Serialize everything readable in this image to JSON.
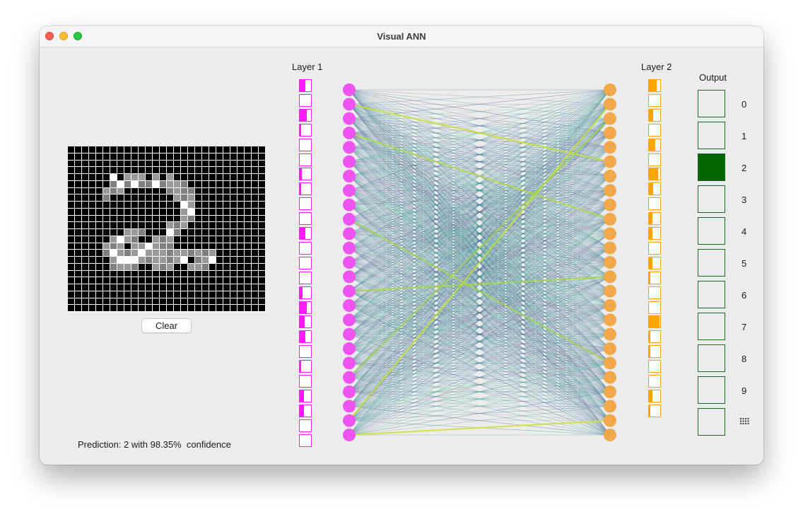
{
  "window": {
    "title": "Visual ANN"
  },
  "input_grid": {
    "size": 28,
    "on_color": "#ffffff",
    "off_color": "#000000",
    "active_levels": {
      "4": [
        [
          6,
          1.0
        ],
        [
          8,
          0.6
        ],
        [
          9,
          0.6
        ],
        [
          10,
          0.6
        ],
        [
          12,
          0.6
        ],
        [
          14,
          0.6
        ]
      ],
      "5": [
        [
          6,
          0.5
        ],
        [
          7,
          1.0
        ],
        [
          8,
          0.5
        ],
        [
          9,
          1.0
        ],
        [
          10,
          0.5
        ],
        [
          11,
          0.5
        ],
        [
          12,
          1.0
        ],
        [
          13,
          0.5
        ],
        [
          14,
          0.6
        ],
        [
          15,
          0.6
        ],
        [
          16,
          0.5
        ]
      ],
      "6": [
        [
          5,
          0.6
        ],
        [
          6,
          0.5
        ],
        [
          7,
          0.6
        ],
        [
          14,
          0.5
        ],
        [
          15,
          0.6
        ],
        [
          16,
          0.5
        ],
        [
          17,
          0.5
        ]
      ],
      "7": [
        [
          5,
          0.5
        ],
        [
          15,
          0.6
        ],
        [
          16,
          0.5
        ],
        [
          17,
          0.6
        ]
      ],
      "8": [
        [
          16,
          1.0
        ],
        [
          17,
          0.6
        ]
      ],
      "9": [
        [
          16,
          0.6
        ],
        [
          17,
          1.0
        ]
      ],
      "10": [
        [
          16,
          0.6
        ],
        [
          17,
          0.5
        ]
      ],
      "11": [
        [
          14,
          0.6
        ],
        [
          15,
          0.5
        ],
        [
          16,
          0.6
        ]
      ],
      "12": [
        [
          8,
          0.6
        ],
        [
          9,
          0.6
        ],
        [
          10,
          0.5
        ],
        [
          14,
          1.0
        ],
        [
          15,
          0.5
        ]
      ],
      "13": [
        [
          6,
          0.6
        ],
        [
          7,
          1.0
        ],
        [
          8,
          0.6
        ],
        [
          9,
          0.5
        ],
        [
          12,
          0.6
        ],
        [
          13,
          0.5
        ],
        [
          14,
          0.6
        ]
      ],
      "14": [
        [
          5,
          0.6
        ],
        [
          6,
          0.5
        ],
        [
          7,
          0.6
        ],
        [
          9,
          0.6
        ],
        [
          10,
          0.6
        ],
        [
          11,
          1.0
        ],
        [
          12,
          0.6
        ],
        [
          13,
          0.5
        ],
        [
          14,
          0.5
        ]
      ],
      "15": [
        [
          5,
          0.5
        ],
        [
          6,
          1.0
        ],
        [
          7,
          0.6
        ],
        [
          8,
          0.5
        ],
        [
          9,
          0.6
        ],
        [
          10,
          1.0
        ],
        [
          11,
          0.6
        ],
        [
          12,
          0.6
        ],
        [
          13,
          0.6
        ],
        [
          14,
          0.5
        ],
        [
          15,
          0.6
        ],
        [
          16,
          0.6
        ],
        [
          17,
          0.5
        ],
        [
          18,
          0.6
        ],
        [
          19,
          0.5
        ],
        [
          20,
          0.6
        ]
      ],
      "16": [
        [
          6,
          0.6
        ],
        [
          7,
          1.0
        ],
        [
          8,
          1.0
        ],
        [
          9,
          1.0
        ],
        [
          10,
          0.6
        ],
        [
          11,
          0.5
        ],
        [
          12,
          0.6
        ],
        [
          13,
          0.6
        ],
        [
          14,
          0.5
        ],
        [
          15,
          0.6
        ],
        [
          16,
          1.0
        ],
        [
          18,
          0.5
        ],
        [
          19,
          0.6
        ],
        [
          20,
          1.0
        ]
      ],
      "17": [
        [
          6,
          0.5
        ],
        [
          7,
          0.6
        ],
        [
          8,
          0.6
        ],
        [
          9,
          0.5
        ],
        [
          12,
          0.6
        ],
        [
          13,
          0.5
        ],
        [
          14,
          0.6
        ],
        [
          17,
          0.6
        ],
        [
          18,
          0.6
        ],
        [
          19,
          0.5
        ]
      ]
    }
  },
  "clear_button": {
    "label": "Clear"
  },
  "prediction": {
    "text": "Prediction: 2 with 98.35%  confidence"
  },
  "layer1": {
    "label": "Layer 1",
    "color": "#ff1aff",
    "activations": [
      0.5,
      0.0,
      0.6,
      0.12,
      0.0,
      0.0,
      0.2,
      0.15,
      0.0,
      0.0,
      0.5,
      0.0,
      0.0,
      0.0,
      0.25,
      0.6,
      0.45,
      0.5,
      0.0,
      0.15,
      0.0,
      0.35,
      0.4,
      0.0,
      0.0
    ]
  },
  "layer2": {
    "label": "Layer 2",
    "color": "#ffa500",
    "activations": [
      0.7,
      0.0,
      0.35,
      0.0,
      0.55,
      0.0,
      0.8,
      0.35,
      0.0,
      0.3,
      0.3,
      0.0,
      0.3,
      0.1,
      0.0,
      0.0,
      0.95,
      0.1,
      0.1,
      0.0,
      0.0,
      0.3,
      0.1
    ]
  },
  "network": {
    "left_node_color": "#f054f0",
    "right_node_color": "#f0a848",
    "left_nodes": 25,
    "right_nodes": 25
  },
  "output": {
    "label": "Output",
    "active_color": "#006400",
    "border_color": "#1c6b1c",
    "digits": [
      "0",
      "1",
      "2",
      "3",
      "4",
      "5",
      "6",
      "7",
      "8",
      "9"
    ],
    "activations": [
      0,
      0,
      1,
      0,
      0,
      0,
      0,
      0,
      0,
      0
    ],
    "more_icon": "grid-dots-icon"
  }
}
